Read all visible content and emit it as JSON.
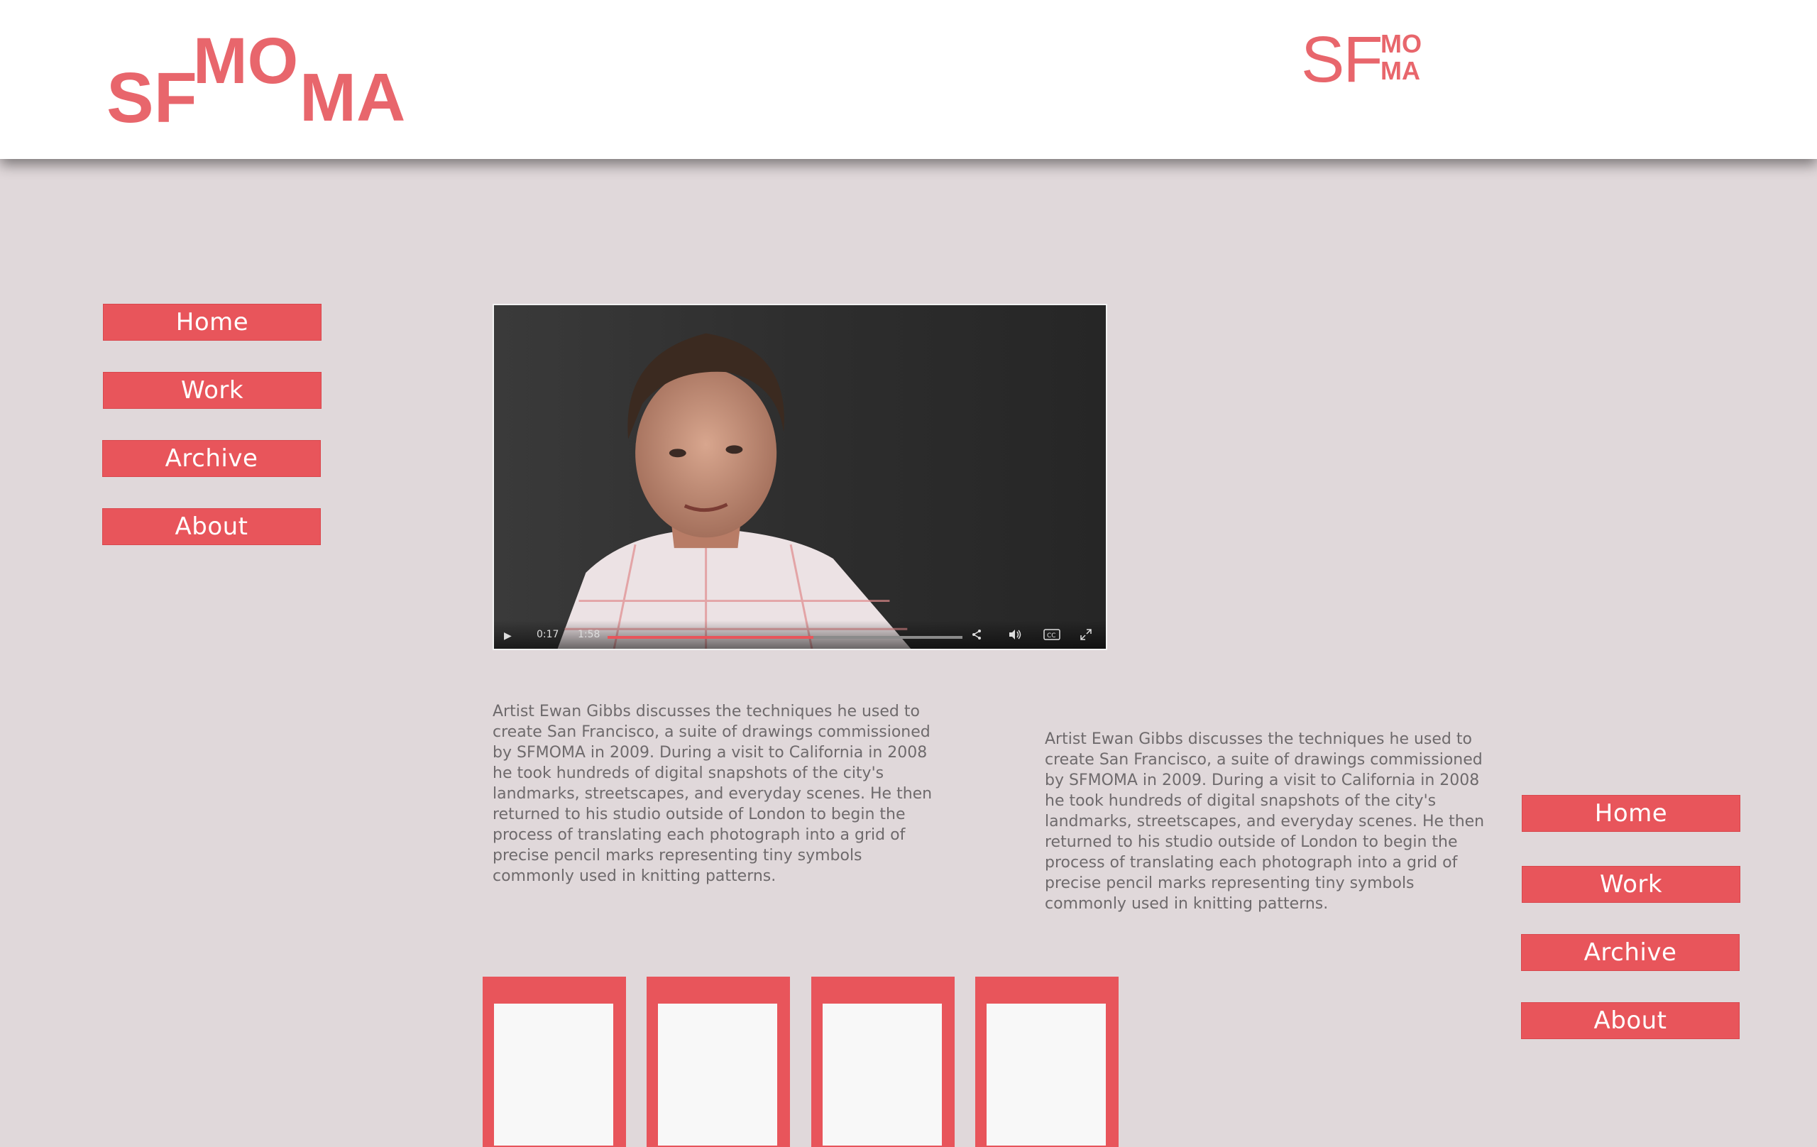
{
  "header": {
    "logo_large": {
      "sf": "SF",
      "mo": "MO",
      "ma": "MA"
    },
    "logo_small": {
      "sf": "SF",
      "mo": "MO",
      "ma": "MA"
    }
  },
  "nav_left": {
    "items": [
      {
        "label": "Home"
      },
      {
        "label": "Work"
      },
      {
        "label": "Archive"
      },
      {
        "label": "About"
      }
    ]
  },
  "nav_right": {
    "items": [
      {
        "label": "Home"
      },
      {
        "label": "Work"
      },
      {
        "label": "Archive"
      },
      {
        "label": "About"
      }
    ]
  },
  "video": {
    "current_time": "0:17",
    "duration": "1:58",
    "progress": 0.58
  },
  "description_left": "Artist Ewan Gibbs discusses the techniques he used to\ncreate San Francisco, a suite of drawings commissioned\nby SFMOMA in 2009. During a visit to California in 2008\nhe took hundreds of digital snapshots of the city's\nlandmarks, streetscapes, and everyday scenes. He then\nreturned to his studio outside of London to begin the\nprocess of translating each photograph into a grid of\nprecise pencil marks representing tiny symbols\ncommonly used in knitting patterns.",
  "description_right": "Artist Ewan Gibbs discusses the techniques he used to\ncreate San Francisco, a suite of drawings commissioned\nby SFMOMA in 2009. During a visit to California in 2008\nhe took hundreds of digital snapshots of the city's\nlandmarks, streetscapes, and everyday scenes. He then\nreturned to his studio outside of London to begin the\nprocess of translating each photograph into a grid of\nprecise pencil marks representing tiny symbols\ncommonly used in knitting patterns.",
  "colors": {
    "accent": "#e8555b",
    "logo": "#e8666c",
    "background": "#e0d8da",
    "text": "#6e6a6c"
  },
  "icons": [
    "play-icon",
    "share-icon",
    "volume-icon",
    "closed-captions-icon",
    "fullscreen-icon"
  ]
}
